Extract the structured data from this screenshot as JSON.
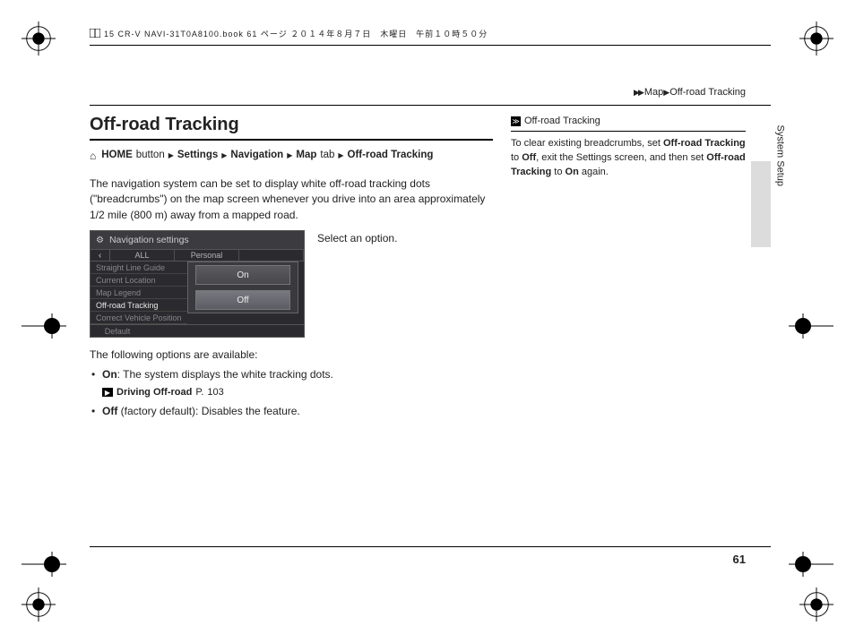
{
  "file_header": "15 CR-V NAVI-31T0A8100.book  61 ページ   ２０１４年８月７日　木曜日　午前１０時５０分",
  "breadcrumb": {
    "arrow": "▶▶",
    "a": "Map",
    "sep": "▶",
    "b": "Off-road Tracking"
  },
  "title": "Off-road Tracking",
  "path": {
    "home_bold": "HOME",
    "home_rest": "button",
    "s": "Settings",
    "n": "Navigation",
    "m": "Map",
    "m_rest": "tab",
    "o": "Off-road Tracking",
    "tri": "▶"
  },
  "intro": "The navigation system can be set to display white off-road tracking dots (\"breadcrumbs\") on the map screen whenever you drive into an area approximately 1/2 mile (800 m) away from a mapped road.",
  "select_option": "Select an option.",
  "screenshot": {
    "title": "Navigation settings",
    "back": "‹",
    "tabs": [
      "ALL",
      "Personal"
    ],
    "items": [
      "Straight Line Guide",
      "Current Location",
      "Map Legend",
      "Off-road Tracking",
      "Correct Vehicle Position"
    ],
    "active_index": 3,
    "options": [
      "On",
      "Off"
    ],
    "selected_option_index": 1,
    "footer_btn": "Default"
  },
  "following": "The following options are available:",
  "opt_on_label": "On",
  "opt_on_text": ": The system displays the white tracking dots.",
  "xref_label": "Driving Off-road",
  "xref_page_label": "P.",
  "xref_page_num": "103",
  "opt_off_label": "Off",
  "opt_off_text": " (factory default): Disables the feature.",
  "tip_title": "Off-road Tracking",
  "tip_body_1": "To clear existing breadcrumbs, set ",
  "tip_bold_1": "Off-road Tracking",
  "tip_body_2": " to ",
  "tip_bold_2": "Off",
  "tip_body_3": ", exit the Settings screen, and then set ",
  "tip_bold_3": "Off-road Tracking",
  "tip_body_4": " to ",
  "tip_bold_4": "On",
  "tip_body_5": " again.",
  "side_tab": "System Setup",
  "page_number": "61"
}
